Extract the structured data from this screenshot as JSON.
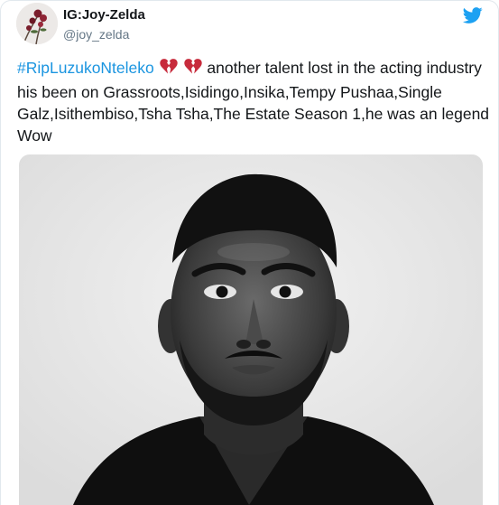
{
  "tweet": {
    "display_name": "IG:Joy-Zelda",
    "handle": "@joy_zelda",
    "hashtag": "#RipLuzukoNteleko",
    "emojis": [
      "broken-heart-emoji",
      "broken-heart-emoji"
    ],
    "body": "another talent lost in the acting industry his been on Grassroots,Isidingo,Insika,Tempy Pushaa,Single Galz,Isithembiso,Tsha Tsha,The Estate Season 1,he was an legend Wow",
    "media": "portrait-photo"
  },
  "icons": {
    "brand": "twitter-bird-icon"
  },
  "colors": {
    "hashtag": "#1b95e0",
    "twitter_blue": "#1da1f2",
    "emoji_red": "#c72b3c",
    "text": "#14171a",
    "muted": "#657786"
  }
}
